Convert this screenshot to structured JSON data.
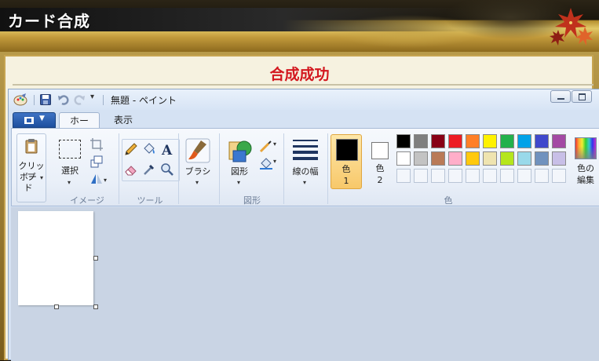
{
  "game": {
    "title": "カード合成",
    "result_title": "合成成功"
  },
  "paint": {
    "window_title": "無題 - ペイント",
    "tabs": {
      "home": "ホーム",
      "view": "表示"
    },
    "groups": {
      "image": "イメージ",
      "tools": "ツール",
      "shapes": "図形",
      "colors": "色"
    },
    "buttons": {
      "clipboard_line1": "クリップ",
      "clipboard_line2": "ボード",
      "select": "選択",
      "brush": "ブラシ",
      "shapes": "図形",
      "line_width": "線の幅",
      "color1_line1": "色",
      "color1_line2": "1",
      "color2_line1": "色",
      "color2_line2": "2",
      "edit_colors_line1": "色の",
      "edit_colors_line2": "編集"
    },
    "color1": "#000000",
    "color2": "#ffffff",
    "palette_row1": [
      "#000000",
      "#7f7f7f",
      "#880015",
      "#ed1c24",
      "#ff7f27",
      "#fff200",
      "#22b14c",
      "#00a2e8",
      "#3f48cc",
      "#a349a4"
    ],
    "palette_row2": [
      "#ffffff",
      "#c3c3c3",
      "#b97a57",
      "#ffaec9",
      "#ffc90e",
      "#efe4b0",
      "#b5e61d",
      "#99d9ea",
      "#7092be",
      "#c8bfe7"
    ],
    "palette_row3_count": 10,
    "icons": {
      "app": "paint-app-icon",
      "save": "save-icon",
      "undo": "undo-icon",
      "redo": "redo-icon",
      "pencil": "pencil-icon",
      "fill": "fill-bucket-icon",
      "text": "text-icon",
      "eraser": "eraser-icon",
      "picker": "color-picker-icon",
      "magnifier": "magnifier-icon"
    }
  }
}
